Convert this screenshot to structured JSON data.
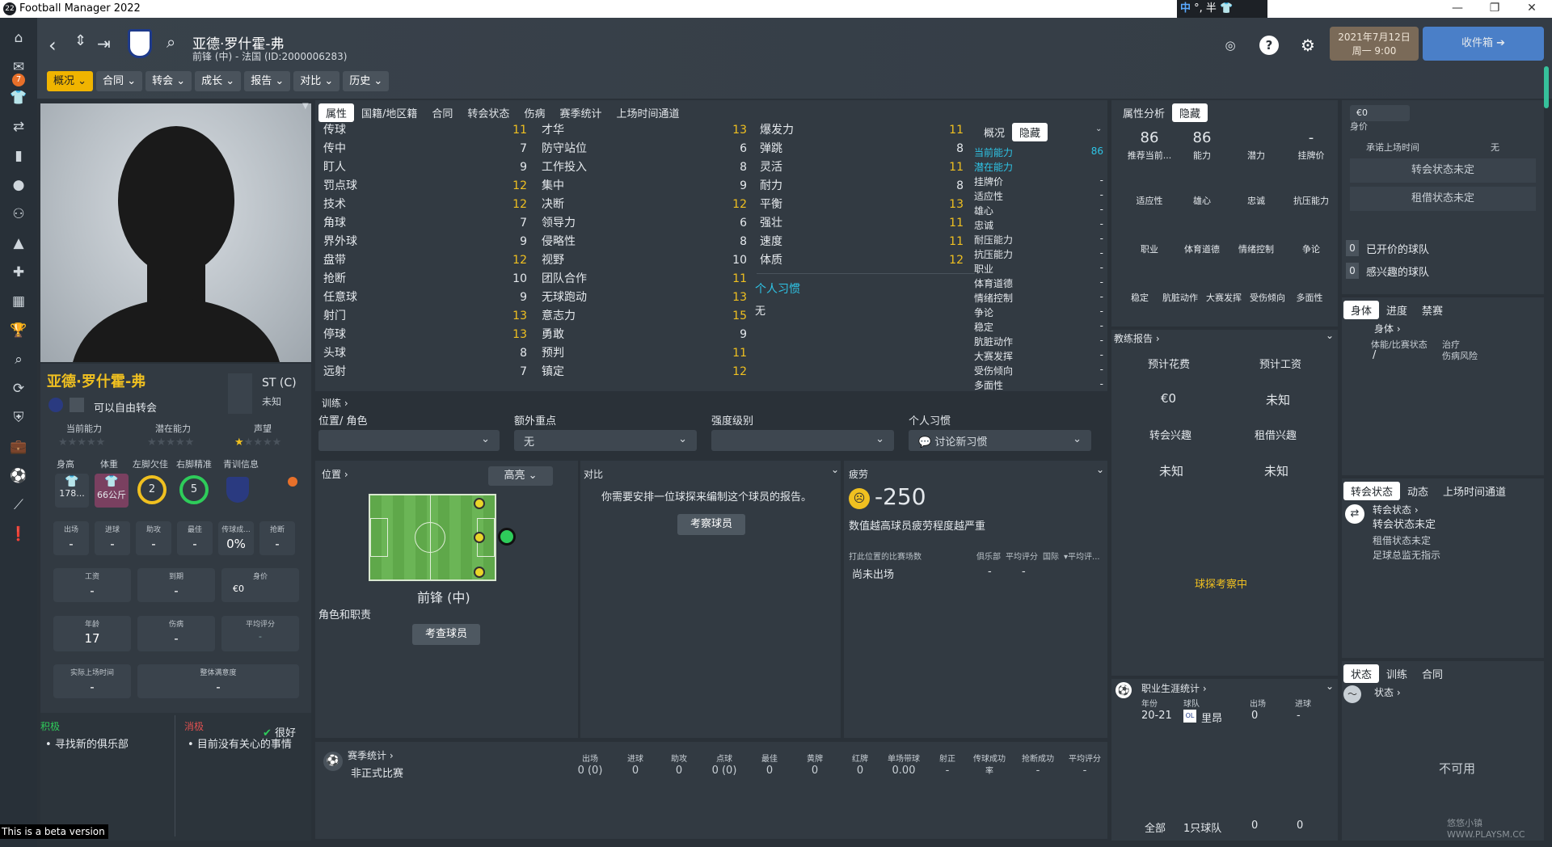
{
  "window": {
    "title": "Football Manager 2022",
    "ime": {
      "zh": "中",
      "rest": "°, 半"
    },
    "beta_notice": "This is a beta version"
  },
  "nav": {
    "inbox_badge": "7"
  },
  "header": {
    "player_name": "亚德·罗什霍-弗",
    "player_sub": "前锋 (中) - 法国 (ID:2000006283)",
    "date_line1": "2021年7月12日",
    "date_line2": "周一 9:00",
    "inbox_label": "收件箱",
    "help": "?",
    "menu": [
      "概况",
      "合同",
      "转会",
      "成长",
      "报告",
      "对比",
      "历史"
    ]
  },
  "profile": {
    "name": "亚德·罗什霍-弗",
    "transfer_status": "可以自由转会",
    "position_code": "ST (C)",
    "position_note": "未知",
    "ratings_labels": [
      "当前能力",
      "潜在能力",
      "声望"
    ],
    "physical_labels": [
      "身高",
      "体重",
      "左脚欠佳",
      "右脚精准",
      "青训信息"
    ],
    "height": "178...",
    "weight": "66公斤",
    "left_foot": "2",
    "right_foot": "5",
    "stats": [
      {
        "label": "出场",
        "value": "-"
      },
      {
        "label": "进球",
        "value": "-"
      },
      {
        "label": "助攻",
        "value": "-"
      },
      {
        "label": "最佳",
        "value": "-"
      },
      {
        "label": "传球成...",
        "value": "0%"
      },
      {
        "label": "抢断",
        "value": "-"
      }
    ],
    "finance": [
      {
        "label": "工资",
        "value": "-"
      },
      {
        "label": "到期",
        "value": "-"
      },
      {
        "label": "身价",
        "value": "€0"
      }
    ],
    "info": [
      {
        "label": "年龄",
        "value": "17"
      },
      {
        "label": "伤病",
        "value": "-"
      },
      {
        "label": "平均评分",
        "value": "-"
      }
    ],
    "playtime": {
      "label": "实际上场时间",
      "value": "-"
    },
    "satisfaction": {
      "label": "整体满意度",
      "value": "-"
    },
    "positive_label": "积极",
    "positive_item": "寻找新的俱乐部",
    "negative_label": "消极",
    "negative_item": "目前没有关心的事情",
    "mood": "很好"
  },
  "attributes": {
    "tabs": [
      "属性",
      "国籍/地区籍",
      "合同",
      "转会状态",
      "伤病",
      "赛季统计",
      "上场时间通道"
    ],
    "technical": [
      {
        "name": "传球",
        "value": "11"
      },
      {
        "name": "传中",
        "value": "7"
      },
      {
        "name": "盯人",
        "value": "9"
      },
      {
        "name": "罚点球",
        "value": "12"
      },
      {
        "name": "技术",
        "value": "12"
      },
      {
        "name": "角球",
        "value": "7"
      },
      {
        "name": "界外球",
        "value": "9"
      },
      {
        "name": "盘带",
        "value": "12"
      },
      {
        "name": "抢断",
        "value": "10"
      },
      {
        "name": "任意球",
        "value": "9"
      },
      {
        "name": "射门",
        "value": "13"
      },
      {
        "name": "停球",
        "value": "13"
      },
      {
        "name": "头球",
        "value": "8"
      },
      {
        "name": "远射",
        "value": "7"
      }
    ],
    "mental": [
      {
        "name": "才华",
        "value": "13"
      },
      {
        "name": "防守站位",
        "value": "6"
      },
      {
        "name": "工作投入",
        "value": "8"
      },
      {
        "name": "集中",
        "value": "9"
      },
      {
        "name": "决断",
        "value": "12"
      },
      {
        "name": "领导力",
        "value": "6"
      },
      {
        "name": "侵略性",
        "value": "8"
      },
      {
        "name": "视野",
        "value": "10"
      },
      {
        "name": "团队合作",
        "value": "11"
      },
      {
        "name": "无球跑动",
        "value": "13"
      },
      {
        "name": "意志力",
        "value": "15"
      },
      {
        "name": "勇敢",
        "value": "9"
      },
      {
        "name": "预判",
        "value": "11"
      },
      {
        "name": "镇定",
        "value": "12"
      }
    ],
    "physical": [
      {
        "name": "爆发力",
        "value": "11"
      },
      {
        "name": "弹跳",
        "value": "8"
      },
      {
        "name": "灵活",
        "value": "11"
      },
      {
        "name": "耐力",
        "value": "8"
      },
      {
        "name": "平衡",
        "value": "13"
      },
      {
        "name": "强壮",
        "value": "11"
      },
      {
        "name": "速度",
        "value": "11"
      },
      {
        "name": "体质",
        "value": "12"
      }
    ],
    "habits_title": "个人习惯",
    "habits_value": "无"
  },
  "personality": {
    "tabs": [
      "概况",
      "隐藏"
    ],
    "rows": [
      {
        "name": "当前能力",
        "value": "86",
        "hl": true
      },
      {
        "name": "潜在能力",
        "value": "",
        "hl": true
      },
      {
        "name": "挂牌价",
        "value": "-"
      },
      {
        "name": "适应性",
        "value": "-"
      },
      {
        "name": "雄心",
        "value": "-"
      },
      {
        "name": "忠诚",
        "value": "-"
      },
      {
        "name": "耐压能力",
        "value": "-"
      },
      {
        "name": "抗压能力",
        "value": "-"
      },
      {
        "name": "职业",
        "value": "-"
      },
      {
        "name": "体育道德",
        "value": "-"
      },
      {
        "name": "情绪控制",
        "value": "-"
      },
      {
        "name": "争论",
        "value": "-"
      },
      {
        "name": "稳定",
        "value": "-"
      },
      {
        "name": "肮脏动作",
        "value": "-"
      },
      {
        "name": "大赛发挥",
        "value": "-"
      },
      {
        "name": "受伤倾向",
        "value": "-"
      },
      {
        "name": "多面性",
        "value": "-"
      }
    ]
  },
  "training": {
    "title": "训练",
    "labels": [
      "位置/ 角色",
      "额外重点",
      "强度级别",
      "个人习惯"
    ],
    "values": [
      "",
      "无",
      "",
      "讨论新习惯"
    ]
  },
  "position_panel": {
    "title": "位置",
    "highlight": "高亮",
    "position": "前锋 (中)",
    "role_title": "角色和职责",
    "check_button": "考查球员"
  },
  "compare_panel": {
    "title": "对比",
    "message": "你需要安排一位球探来编制这个球员的报告。",
    "button": "考察球员"
  },
  "fatigue_panel": {
    "title": "疲劳",
    "value": "-250",
    "note": "数值越高球员疲劳程度越严重",
    "table_headers": [
      "打此位置的比赛场数",
      "俱乐部",
      "平均评分",
      "国际",
      "平均评..."
    ],
    "row_label": "尚未出场",
    "row_values": [
      "-",
      "-"
    ]
  },
  "season_stats": {
    "title": "赛季统计",
    "headers": [
      "出场",
      "进球",
      "助攻",
      "点球",
      "最佳",
      "黄牌",
      "红牌",
      "单场带球",
      "射正",
      "传球成功率",
      "抢断成功",
      "平均评分"
    ],
    "row_label": "非正式比赛",
    "values": [
      "0 (0)",
      "0",
      "0",
      "0 (0)",
      "0",
      "0",
      "0",
      "0.00",
      "-",
      "-",
      "-",
      "-"
    ]
  },
  "analysis": {
    "tabs": [
      "属性分析",
      "隐藏"
    ],
    "top_values": [
      "86",
      "86",
      "",
      "-"
    ],
    "top_labels": [
      "推荐当前...",
      "能力",
      "潜力",
      "挂牌价"
    ],
    "row2": [
      "适应性",
      "雄心",
      "忠诚",
      "抗压能力"
    ],
    "row3": [
      "职业",
      "体育道德",
      "情绪控制",
      "争论"
    ],
    "row4": [
      "稳定",
      "肮脏动作",
      "大赛发挥",
      "受伤倾向",
      "多面性"
    ]
  },
  "coach_report": {
    "title": "教练报告",
    "labels": [
      "预计花费",
      "预计工资",
      "转会兴趣",
      "租借兴趣"
    ],
    "values": [
      "€0",
      "未知",
      "未知",
      "未知"
    ],
    "scouting": "球探考察中"
  },
  "career": {
    "title": "职业生涯统计",
    "headers": [
      "年份",
      "球队",
      "出场",
      "进球"
    ],
    "row": [
      "20-21",
      "里昂",
      "0",
      "-"
    ],
    "totals": [
      "全部",
      "1只球队",
      "0",
      "0"
    ]
  },
  "right_col": {
    "value_input": "€0",
    "value_label": "身价",
    "promise_label": "承诺上场时间",
    "promise_value": "无",
    "transfer_undecided": "转会状态未定",
    "loan_undecided": "租借状态未定",
    "clubs_offered_count": "0",
    "clubs_offered": "已开价的球队",
    "clubs_interested_count": "0",
    "clubs_interested": "感兴趣的球队",
    "body_tabs": [
      "身体",
      "进度",
      "禁赛"
    ],
    "body_link": "身体",
    "condition_label": "体能/比赛状态",
    "condition_value": "/",
    "treatment_label": "治疗",
    "injury_risk": "伤病风险",
    "status_tabs": [
      "转会状态",
      "动态",
      "上场时间通道"
    ],
    "transfer_link": "转会状态",
    "transfer_line": "转会状态未定",
    "loan_line": "租借状态未定",
    "fee_line": "足球总监无指示",
    "form_tabs": [
      "状态",
      "训练",
      "合同"
    ],
    "form_link": "状态",
    "unavailable": "不可用"
  },
  "watermark": "悠悠小镇 WWW.PLAYSM.CC",
  "colors": {
    "accent": "#f0c020",
    "highlight": "#2ec4e6",
    "tab_active": "#f0b400"
  }
}
